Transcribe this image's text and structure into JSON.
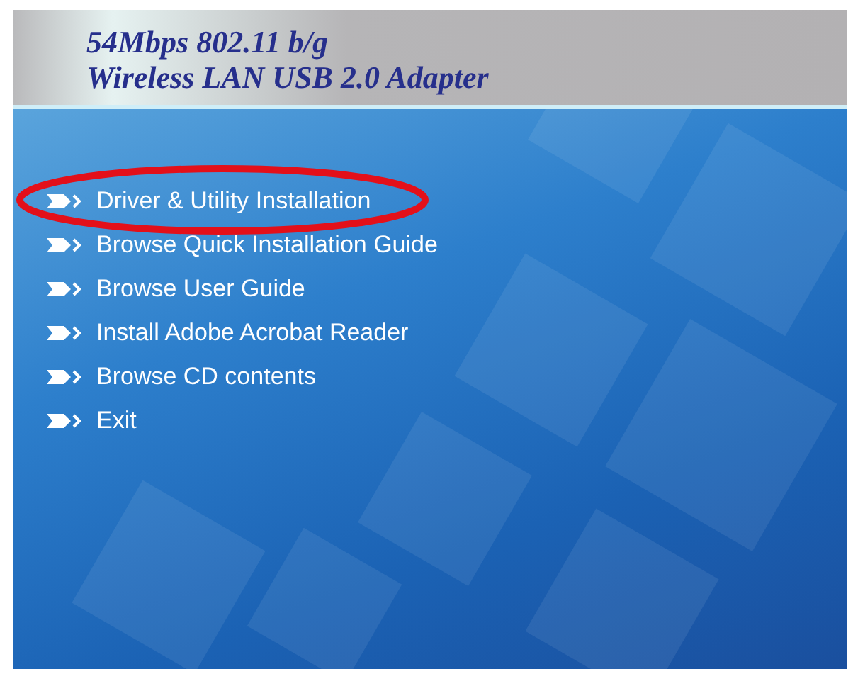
{
  "header": {
    "title_line_1": "54Mbps 802.11 b/g",
    "title_line_2": "Wireless LAN USB 2.0 Adapter"
  },
  "menu": [
    {
      "label": "Driver & Utility Installation",
      "selected": true
    },
    {
      "label": "Browse Quick Installation Guide",
      "selected": false
    },
    {
      "label": "Browse User Guide",
      "selected": false
    },
    {
      "label": "Install Adobe Acrobat Reader",
      "selected": false
    },
    {
      "label": "Browse CD contents",
      "selected": false
    },
    {
      "label": "Exit",
      "selected": false
    }
  ]
}
